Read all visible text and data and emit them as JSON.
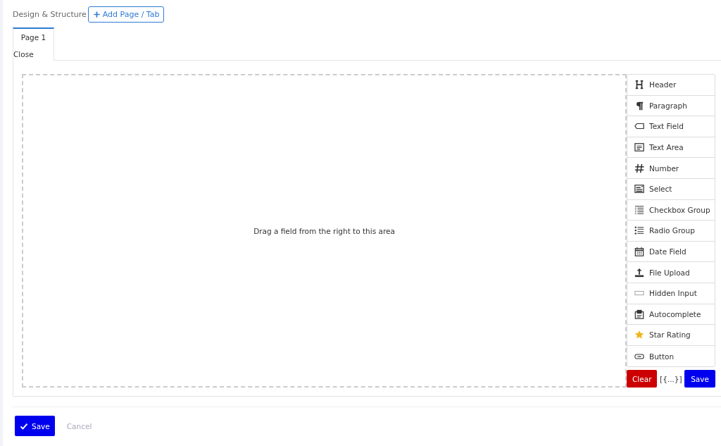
{
  "toolbar": {
    "label": "Design & Structure",
    "add_button": "Add Page / Tab"
  },
  "tabs": [
    {
      "label": "Page 1",
      "close": "Close",
      "selected": true
    }
  ],
  "dropzone": {
    "hint": "Drag a field from the right to this area"
  },
  "fields": [
    {
      "kind": "header",
      "label": "Header"
    },
    {
      "kind": "paragraph",
      "label": "Paragraph"
    },
    {
      "kind": "textfield",
      "label": "Text Field"
    },
    {
      "kind": "textarea",
      "label": "Text Area"
    },
    {
      "kind": "number",
      "label": "Number"
    },
    {
      "kind": "select",
      "label": "Select"
    },
    {
      "kind": "checkbox",
      "label": "Checkbox Group"
    },
    {
      "kind": "radio",
      "label": "Radio Group"
    },
    {
      "kind": "date",
      "label": "Date Field"
    },
    {
      "kind": "upload",
      "label": "File Upload"
    },
    {
      "kind": "hidden",
      "label": "Hidden Input"
    },
    {
      "kind": "autocomplete",
      "label": "Autocomplete"
    },
    {
      "kind": "star",
      "label": "Star Rating"
    },
    {
      "kind": "button",
      "label": "Button"
    }
  ],
  "actions": {
    "clear": "Clear",
    "json": "[{...}]",
    "save": "Save"
  },
  "footer": {
    "save": "Save",
    "cancel": "Cancel"
  }
}
